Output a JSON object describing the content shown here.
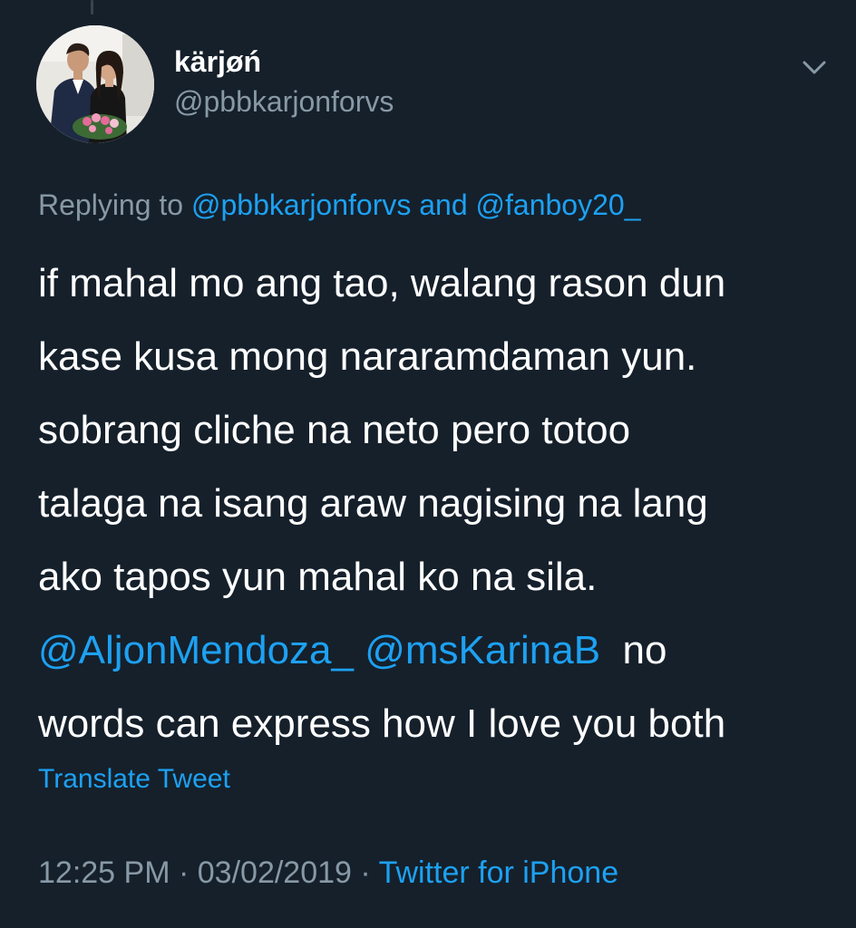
{
  "author": {
    "display_name": "kärjøń",
    "handle": "@pbbkarjonforvs"
  },
  "reply": {
    "prefix": "Replying to",
    "mention_1": "@pbbkarjonforvs",
    "conjunction": "and",
    "mention_2": "@fanboy20_"
  },
  "tweet": {
    "lines": [
      "if mahal mo ang tao, walang rason dun",
      "kase kusa mong nararamdaman yun.",
      "sobrang cliche na neto pero totoo",
      "talaga na isang araw nagising na lang",
      "ako tapos yun mahal ko na sila."
    ],
    "mention_1": "@AljonMendoza_",
    "mention_2": "@msKarinaB",
    "after_mentions": "no",
    "last_line": "words can express how I love you both"
  },
  "translate_label": "Translate Tweet",
  "meta": {
    "time": "12:25 PM",
    "separator": "·",
    "date": "03/02/2019",
    "source": "Twitter for iPhone"
  },
  "icons": {
    "avatar": "profile-photo",
    "menu": "chevron-down-icon"
  },
  "colors": {
    "background": "#15202b",
    "primary_text": "#ffffff",
    "secondary_text": "#8899a6",
    "link": "#1da1f2"
  }
}
